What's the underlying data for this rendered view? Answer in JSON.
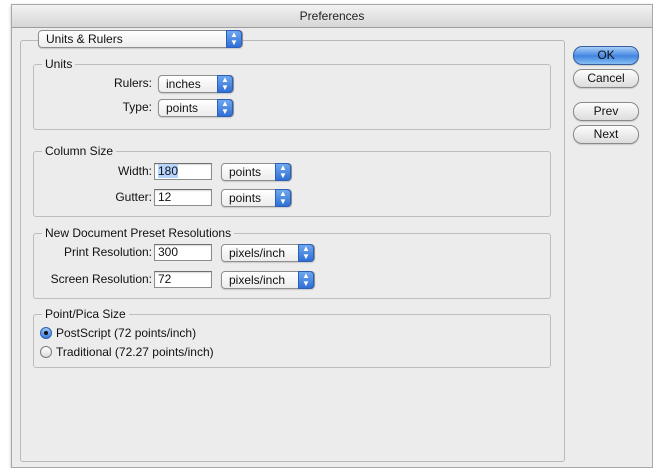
{
  "window": {
    "title": "Preferences"
  },
  "section_popup": {
    "value": "Units & Rulers"
  },
  "buttons": {
    "ok": "OK",
    "cancel": "Cancel",
    "prev": "Prev",
    "next": "Next"
  },
  "units": {
    "label": "Units",
    "rulers_label": "Rulers:",
    "rulers_value": "inches",
    "type_label": "Type:",
    "type_value": "points"
  },
  "column_size": {
    "label": "Column Size",
    "width_label": "Width:",
    "width_value": "180",
    "width_unit": "points",
    "gutter_label": "Gutter:",
    "gutter_value": "12",
    "gutter_unit": "points"
  },
  "preset_resolutions": {
    "label": "New Document Preset Resolutions",
    "print_label": "Print Resolution:",
    "print_value": "300",
    "print_unit": "pixels/inch",
    "screen_label": "Screen Resolution:",
    "screen_value": "72",
    "screen_unit": "pixels/inch"
  },
  "point_pica": {
    "label": "Point/Pica Size",
    "options": [
      {
        "label": "PostScript (72 points/inch)",
        "selected": true
      },
      {
        "label": "Traditional (72.27 points/inch)",
        "selected": false
      }
    ]
  },
  "colors": {
    "accent": "#3f82e0",
    "selection": "#b5d5ff"
  }
}
